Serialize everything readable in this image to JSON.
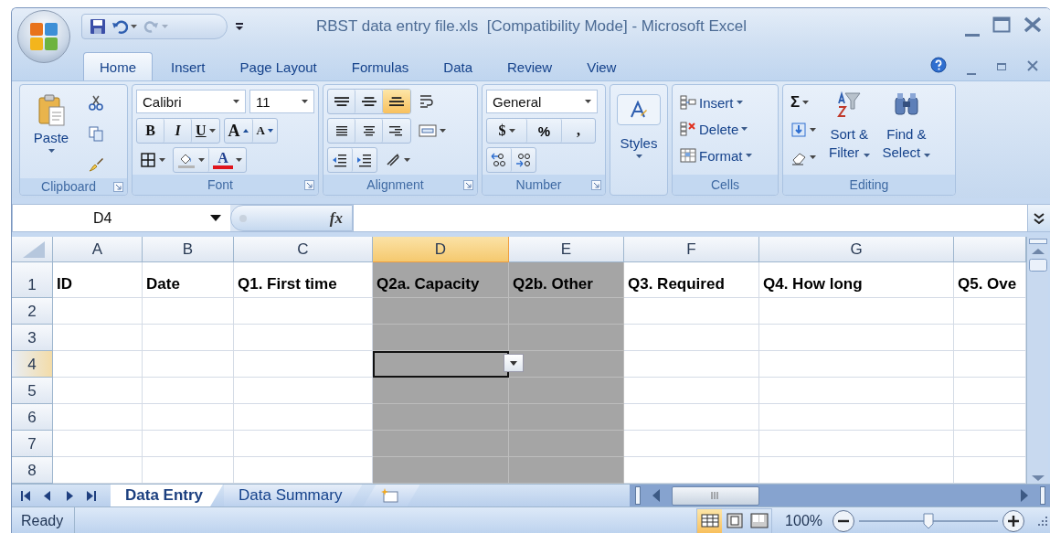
{
  "window": {
    "title": "RBST data entry file.xls  [Compatibility Mode] - Microsoft Excel"
  },
  "ribbon_tabs": [
    {
      "label": "Home",
      "selected": true
    },
    {
      "label": "Insert",
      "selected": false
    },
    {
      "label": "Page Layout",
      "selected": false
    },
    {
      "label": "Formulas",
      "selected": false
    },
    {
      "label": "Data",
      "selected": false
    },
    {
      "label": "Review",
      "selected": false
    },
    {
      "label": "View",
      "selected": false
    }
  ],
  "clipboard": {
    "label": "Clipboard",
    "paste": "Paste"
  },
  "font": {
    "label": "Font",
    "name": "Calibri",
    "size": "11",
    "style_buttons": [
      "B",
      "I",
      "U"
    ],
    "size_buttons": [
      "A",
      "A"
    ],
    "color_button": "A"
  },
  "alignment": {
    "label": "Alignment",
    "vertical_buttons": [
      {
        "kind": "top",
        "selected": false
      },
      {
        "kind": "middle",
        "selected": false
      },
      {
        "kind": "bottom",
        "selected": true
      }
    ]
  },
  "number": {
    "label": "Number",
    "format": "General",
    "symbols": [
      "$",
      "%",
      ","
    ]
  },
  "styles": {
    "label": "Styles"
  },
  "cells": {
    "label": "Cells",
    "commands": [
      "Insert",
      "Delete",
      "Format"
    ]
  },
  "editing": {
    "label": "Editing",
    "sum_symbol": "Σ",
    "commands": [
      {
        "line1": "Sort &",
        "line2": "Filter"
      },
      {
        "line1": "Find &",
        "line2": "Select"
      }
    ]
  },
  "formula_bar": {
    "name_box": "D4",
    "function_symbol": "fx"
  },
  "sheet": {
    "columns": [
      {
        "letter": "A",
        "selected": false,
        "shaded": false
      },
      {
        "letter": "B",
        "selected": false,
        "shaded": false
      },
      {
        "letter": "C",
        "selected": false,
        "shaded": false
      },
      {
        "letter": "D",
        "selected": true,
        "shaded": true
      },
      {
        "letter": "E",
        "selected": false,
        "shaded": true
      },
      {
        "letter": "F",
        "selected": false,
        "shaded": false
      },
      {
        "letter": "G",
        "selected": false,
        "shaded": false
      }
    ],
    "header_cells": [
      "ID",
      "Date",
      "Q1. First time",
      "Q2a. Capacity",
      "Q2b. Other",
      "Q3. Required",
      "Q4. How long",
      "Q5. Ove"
    ],
    "rows": [
      {
        "label": "1",
        "selected": false
      },
      {
        "label": "2",
        "selected": false
      },
      {
        "label": "3",
        "selected": false
      },
      {
        "label": "4",
        "selected": true
      },
      {
        "label": "5",
        "selected": false
      },
      {
        "label": "6",
        "selected": false
      },
      {
        "label": "7",
        "selected": false
      },
      {
        "label": "8",
        "selected": false
      }
    ]
  },
  "sheet_tabs": [
    {
      "label": "Data Entry",
      "selected": true
    },
    {
      "label": "Data Summary",
      "selected": false
    }
  ],
  "status_bar": {
    "text": "Ready",
    "zoom": "100%",
    "zoom_slider": {
      "level": 0.5
    },
    "view_buttons": [
      {
        "kind": "normal",
        "selected": true
      },
      {
        "kind": "page-layout",
        "selected": false
      },
      {
        "kind": "page-break",
        "selected": false
      }
    ]
  }
}
